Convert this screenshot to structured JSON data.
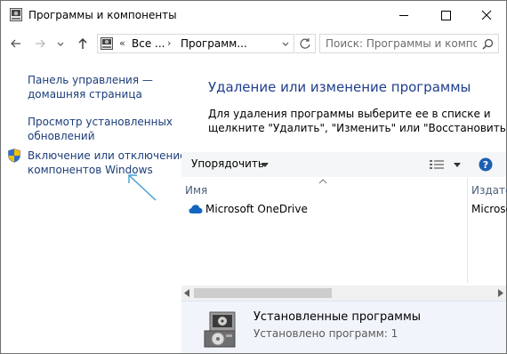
{
  "window": {
    "title": "Программы и компоненты",
    "title_icon": "control-panel-icon",
    "controls": [
      "minimize-icon",
      "maximize-icon",
      "close-icon"
    ]
  },
  "navigation": {
    "back_icon": "back-arrow-icon",
    "forward_icon": "forward-arrow-icon",
    "history_icon": "chevron-down-icon",
    "up_icon": "up-arrow-icon",
    "address": {
      "separator": "«",
      "segment_1": "Все ...",
      "arrow": "›",
      "segment_2": "Программ..."
    },
    "refresh_icon": "refresh-icon",
    "search": {
      "placeholder": "Поиск: Программы и компо...",
      "icon": "search-icon"
    }
  },
  "sidebar": {
    "items": [
      {
        "line1": "Панель управления —",
        "line2": "домашняя страница"
      },
      {
        "line1": "Просмотр установленных",
        "line2": "обновлений"
      },
      {
        "line1": "Включение или отключение",
        "line2": "компонентов Windows",
        "icon": "shield-icon"
      }
    ]
  },
  "main": {
    "heading": "Удаление или изменение программы",
    "description_line1": "Для удаления программы выберите ее в списке и",
    "description_line2": "щелкните \"Удалить\", \"Изменить\" или \"Восстановить\"."
  },
  "toolbar": {
    "organize_label": "Упорядочить",
    "view_icon": "view-options-icon",
    "help_icon": "help-icon"
  },
  "list": {
    "columns": [
      "Имя",
      "Издател"
    ],
    "rows": [
      {
        "name": "Microsoft OneDrive",
        "publisher": "Microso",
        "icon": "onedrive-icon"
      }
    ]
  },
  "details": {
    "title": "Установленные программы",
    "count_text": "Установлено программ: 1",
    "icon": "installer-icon"
  },
  "colors": {
    "link": "#1c3d7a",
    "heading": "#1e3e8c",
    "details_bg": "#f1f5fb",
    "help_blue": "#1e5fb4",
    "annotation": "#3f9fd2"
  }
}
